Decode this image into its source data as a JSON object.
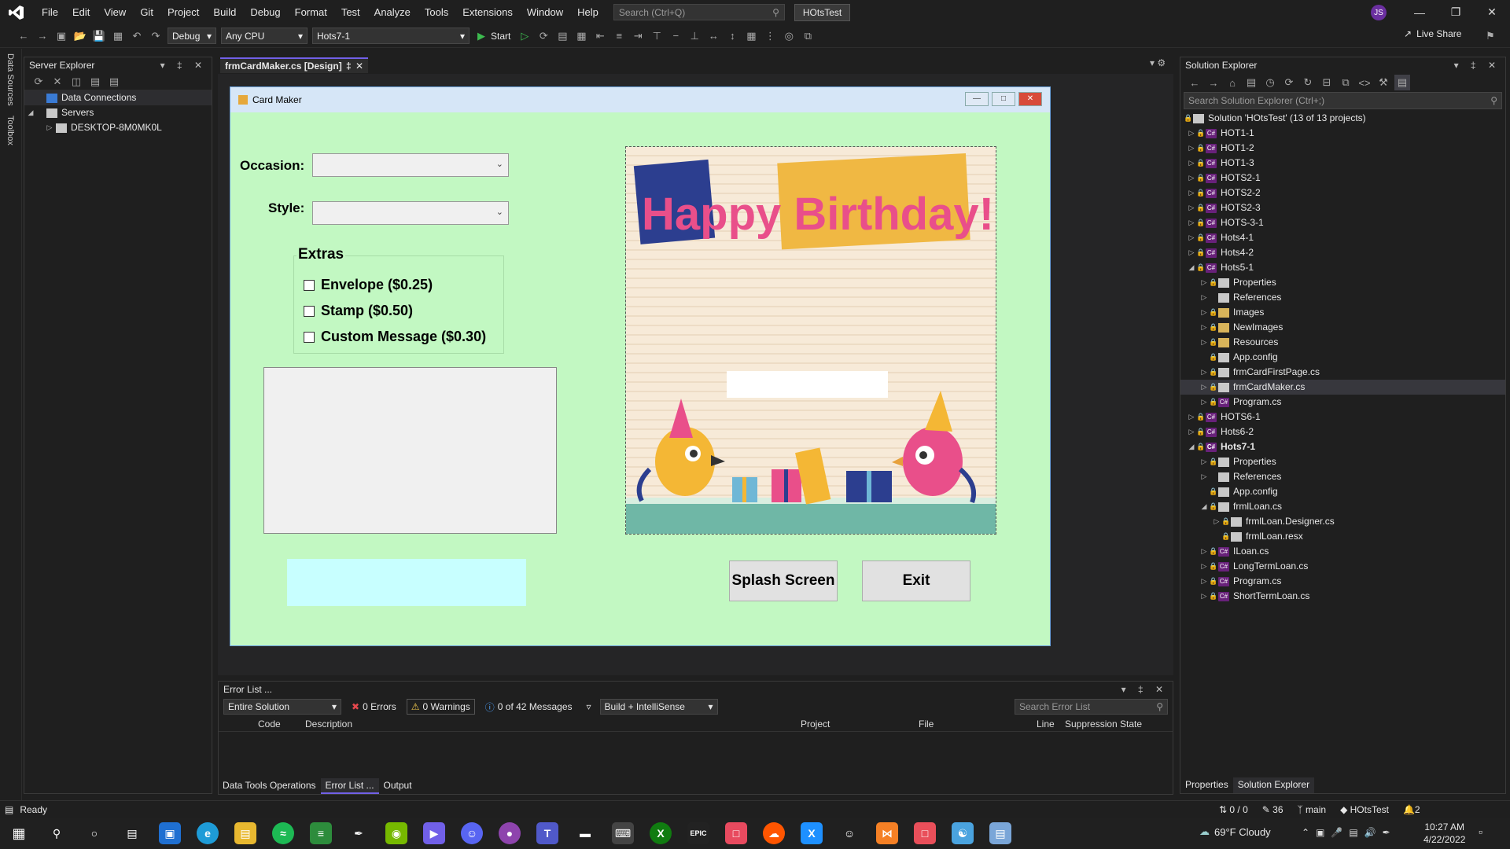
{
  "menubar": {
    "items": [
      "File",
      "Edit",
      "View",
      "Git",
      "Project",
      "Build",
      "Debug",
      "Format",
      "Test",
      "Analyze",
      "Tools",
      "Extensions",
      "Window",
      "Help"
    ],
    "search_placeholder": "Search (Ctrl+Q)",
    "solution_name": "HOtsTest",
    "avatar_initials": "JS"
  },
  "toolbar": {
    "config": "Debug",
    "platform": "Any CPU",
    "startup_project": "Hots7-1",
    "start_label": "Start",
    "live_share": "Live Share"
  },
  "sidestrip": {
    "tabs": [
      "Data Sources",
      "Toolbox"
    ]
  },
  "server_explorer": {
    "title": "Server Explorer",
    "items": [
      "Data Connections",
      "Servers",
      "DESKTOP-8M0MK0L"
    ]
  },
  "doc_tab": {
    "title": "frmCardMaker.cs [Design]"
  },
  "form": {
    "title": "Card Maker",
    "occasion_label": "Occasion:",
    "style_label": "Style:",
    "extras_title": "Extras",
    "extras": [
      "Envelope ($0.25)",
      "Stamp ($0.50)",
      "Custom Message ($0.30)"
    ],
    "splash_button": "Splash Screen",
    "exit_button": "Exit",
    "card_text": "Happy Birthday!"
  },
  "solution_explorer": {
    "title": "Solution Explorer",
    "search_placeholder": "Search Solution Explorer (Ctrl+;)",
    "solution": "Solution 'HOtsTest' (13 of 13 projects)",
    "rows": [
      {
        "label": "HOT1-1",
        "indent": 1,
        "type": "proj",
        "exp": "closed"
      },
      {
        "label": "HOT1-2",
        "indent": 1,
        "type": "proj",
        "exp": "closed"
      },
      {
        "label": "HOT1-3",
        "indent": 1,
        "type": "proj",
        "exp": "closed"
      },
      {
        "label": "HOTS2-1",
        "indent": 1,
        "type": "proj",
        "exp": "closed"
      },
      {
        "label": "HOTS2-2",
        "indent": 1,
        "type": "proj",
        "exp": "closed"
      },
      {
        "label": "HOTS2-3",
        "indent": 1,
        "type": "proj",
        "exp": "closed"
      },
      {
        "label": "HOTS-3-1",
        "indent": 1,
        "type": "proj",
        "exp": "closed"
      },
      {
        "label": "Hots4-1",
        "indent": 1,
        "type": "proj",
        "exp": "closed"
      },
      {
        "label": "Hots4-2",
        "indent": 1,
        "type": "proj",
        "exp": "closed"
      },
      {
        "label": "Hots5-1",
        "indent": 1,
        "type": "proj",
        "exp": "open"
      },
      {
        "label": "Properties",
        "indent": 2,
        "type": "wrench",
        "exp": "closed"
      },
      {
        "label": "References",
        "indent": 2,
        "type": "ref",
        "exp": "closed"
      },
      {
        "label": "Images",
        "indent": 2,
        "type": "folder",
        "exp": "closed"
      },
      {
        "label": "NewImages",
        "indent": 2,
        "type": "folder",
        "exp": "closed"
      },
      {
        "label": "Resources",
        "indent": 2,
        "type": "folder",
        "exp": "closed"
      },
      {
        "label": "App.config",
        "indent": 2,
        "type": "file",
        "exp": "none"
      },
      {
        "label": "frmCardFirstPage.cs",
        "indent": 2,
        "type": "form",
        "exp": "closed"
      },
      {
        "label": "frmCardMaker.cs",
        "indent": 2,
        "type": "form",
        "exp": "closed",
        "selected": true
      },
      {
        "label": "Program.cs",
        "indent": 2,
        "type": "cs",
        "exp": "closed"
      },
      {
        "label": "HOTS6-1",
        "indent": 1,
        "type": "proj",
        "exp": "closed"
      },
      {
        "label": "Hots6-2",
        "indent": 1,
        "type": "proj",
        "exp": "closed"
      },
      {
        "label": "Hots7-1",
        "indent": 1,
        "type": "proj",
        "exp": "open",
        "bold": true
      },
      {
        "label": "Properties",
        "indent": 2,
        "type": "wrench",
        "exp": "closed"
      },
      {
        "label": "References",
        "indent": 2,
        "type": "ref",
        "exp": "closed"
      },
      {
        "label": "App.config",
        "indent": 2,
        "type": "file",
        "exp": "none"
      },
      {
        "label": "frmlLoan.cs",
        "indent": 2,
        "type": "form",
        "exp": "open"
      },
      {
        "label": "frmlLoan.Designer.cs",
        "indent": 3,
        "type": "file",
        "exp": "closed"
      },
      {
        "label": "frmlLoan.resx",
        "indent": 3,
        "type": "file",
        "exp": "none"
      },
      {
        "label": "ILoan.cs",
        "indent": 2,
        "type": "cs",
        "exp": "closed"
      },
      {
        "label": "LongTermLoan.cs",
        "indent": 2,
        "type": "cs",
        "exp": "closed"
      },
      {
        "label": "Program.cs",
        "indent": 2,
        "type": "cs",
        "exp": "closed"
      },
      {
        "label": "ShortTermLoan.cs",
        "indent": 2,
        "type": "cs",
        "exp": "closed"
      }
    ],
    "bottom_tabs": [
      "Properties",
      "Solution Explorer"
    ]
  },
  "error_list": {
    "title": "Error List ...",
    "scope": "Entire Solution",
    "errors": "0 Errors",
    "warnings": "0 Warnings",
    "messages": "0 of 42 Messages",
    "build_filter": "Build + IntelliSense",
    "search_placeholder": "Search Error List",
    "columns": [
      "Code",
      "Description",
      "Project",
      "File",
      "Line",
      "Suppression State"
    ],
    "bottom_tabs": [
      "Data Tools Operations",
      "Error List ...",
      "Output"
    ]
  },
  "statusbar": {
    "status": "Ready",
    "line_col": "0 / 0",
    "edits": "36",
    "branch": "main",
    "repo": "HOtsTest",
    "notifications": "2"
  },
  "taskbar": {
    "weather": "69°F  Cloudy",
    "time": "10:27 AM",
    "date": "4/22/2022"
  },
  "colors": {
    "accent": "#7160e8",
    "form_bg": "#c2f8c2",
    "title_bar": "#d6e6f7",
    "vs_bg": "#1f1f1f"
  }
}
